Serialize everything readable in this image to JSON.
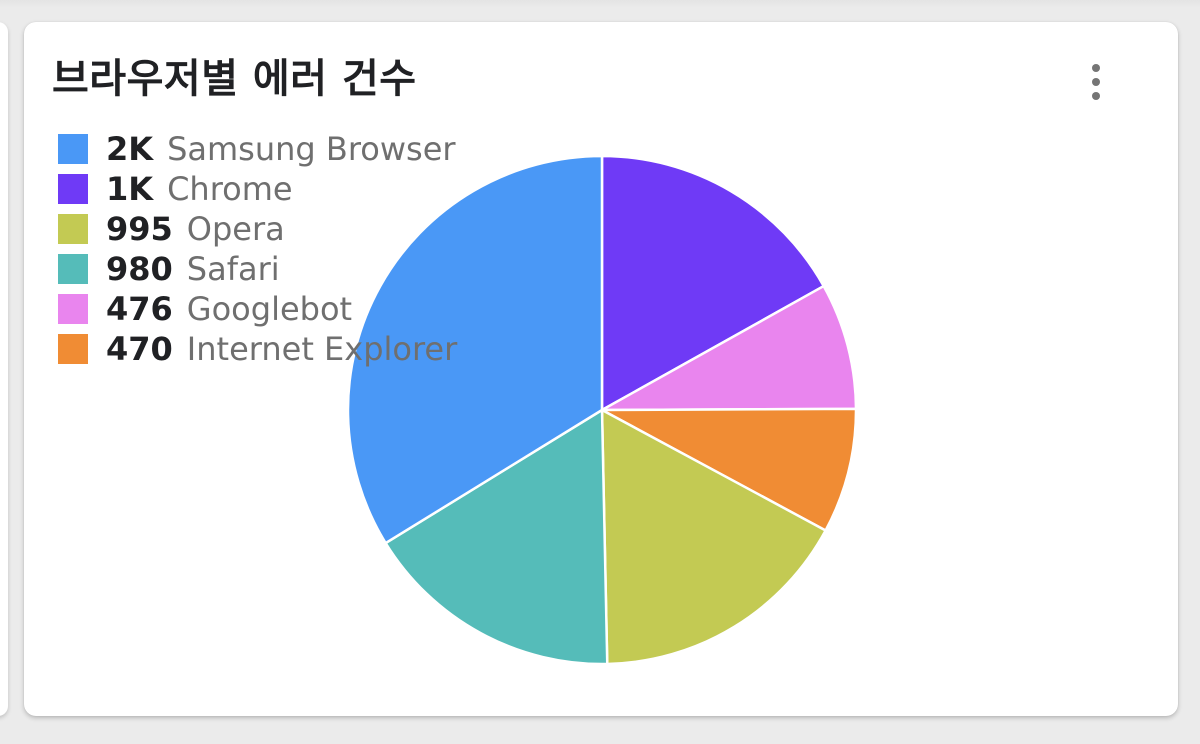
{
  "card": {
    "title": "브라우저별 에러 건수",
    "menu_icon": "more-vert-icon"
  },
  "chart_data": {
    "type": "pie",
    "title": "브라우저별 에러 건수",
    "legend_position": "top-left",
    "slices": [
      {
        "label": "Samsung Browser",
        "value_label": "2K",
        "value": 2000,
        "color": "#4a98f6"
      },
      {
        "label": "Chrome",
        "value_label": "1K",
        "value": 1000,
        "color": "#6f3af6"
      },
      {
        "label": "Opera",
        "value_label": "995",
        "value": 995,
        "color": "#c3ca53"
      },
      {
        "label": "Safari",
        "value_label": "980",
        "value": 980,
        "color": "#55bcb9"
      },
      {
        "label": "Googlebot",
        "value_label": "476",
        "value": 476,
        "color": "#e985ee"
      },
      {
        "label": "Internet Explorer",
        "value_label": "470",
        "value": 470,
        "color": "#f08c34"
      }
    ],
    "draw_order": [
      "Chrome",
      "Googlebot",
      "Internet Explorer",
      "Opera",
      "Safari",
      "Samsung Browser"
    ]
  }
}
